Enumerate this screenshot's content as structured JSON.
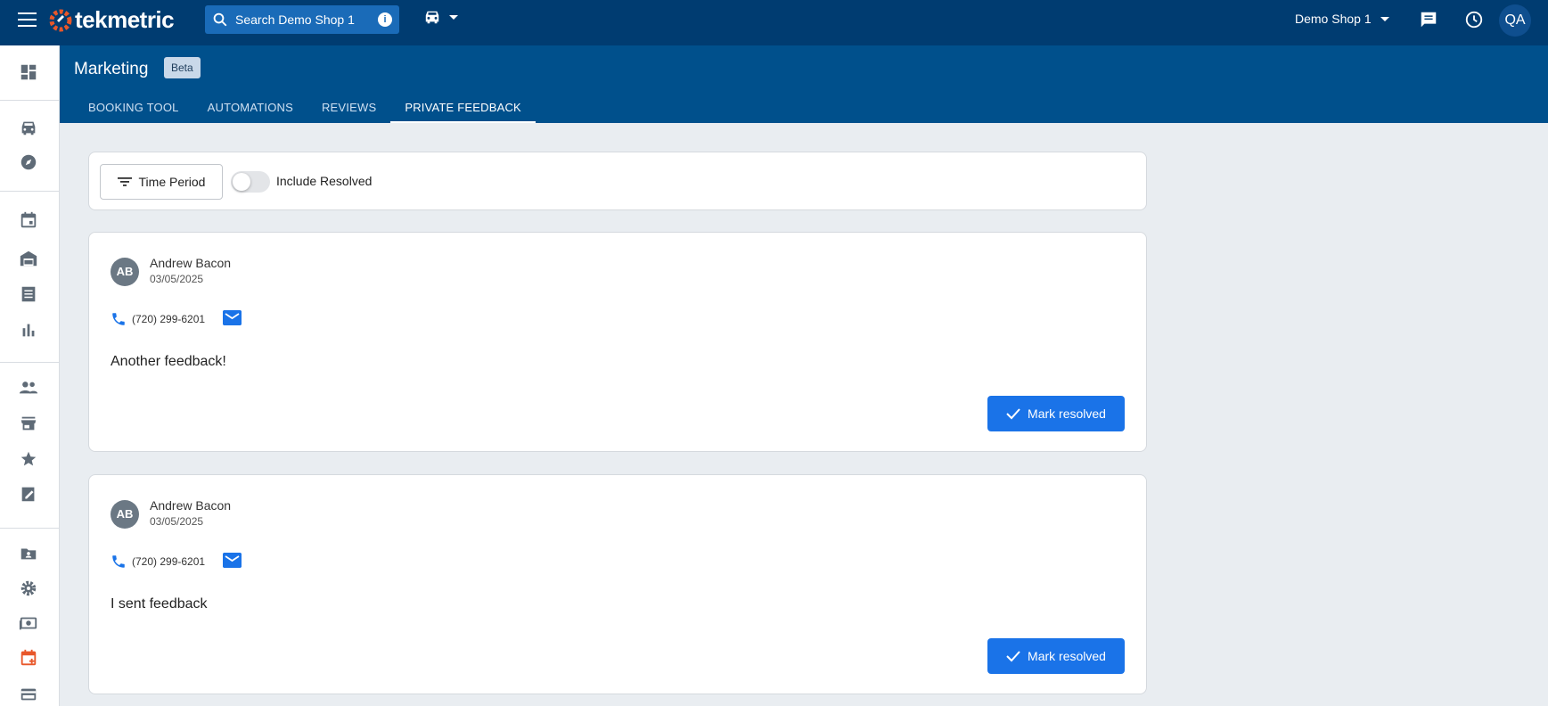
{
  "app": {
    "logo_text": "tekmetric"
  },
  "topbar": {
    "search_placeholder": "Search Demo Shop 1",
    "shop_name": "Demo Shop 1",
    "user_initials": "QA"
  },
  "header": {
    "title": "Marketing",
    "badge": "Beta",
    "tabs": [
      {
        "label": "BOOKING TOOL"
      },
      {
        "label": "AUTOMATIONS"
      },
      {
        "label": "REVIEWS"
      },
      {
        "label": "PRIVATE FEEDBACK"
      }
    ],
    "active_tab": "PRIVATE FEEDBACK"
  },
  "filters": {
    "time_period_label": "Time Period",
    "include_resolved_label": "Include Resolved",
    "include_resolved": false
  },
  "feedback": [
    {
      "initials": "AB",
      "name": "Andrew Bacon",
      "date": "03/05/2025",
      "phone": "(720) 299-6201",
      "message": "Another feedback!",
      "action_label": "Mark resolved"
    },
    {
      "initials": "AB",
      "name": "Andrew Bacon",
      "date": "03/05/2025",
      "phone": "(720) 299-6201",
      "message": "I sent feedback",
      "action_label": "Mark resolved"
    }
  ],
  "sidebar_icons": [
    "dashboard-icon",
    "car-icon",
    "compass-icon",
    "calendar-icon",
    "garage-icon",
    "list-icon",
    "bar-chart-icon",
    "people-icon",
    "store-icon",
    "star-icon",
    "edit-note-icon",
    "contact-card-icon",
    "gear-icon",
    "payments-icon",
    "calendar-add-icon",
    "credit-card-icon"
  ],
  "colors": {
    "topbar": "#003c71",
    "header": "#00508c",
    "primary": "#1a73e8",
    "accent_orange": "#e8572a"
  }
}
